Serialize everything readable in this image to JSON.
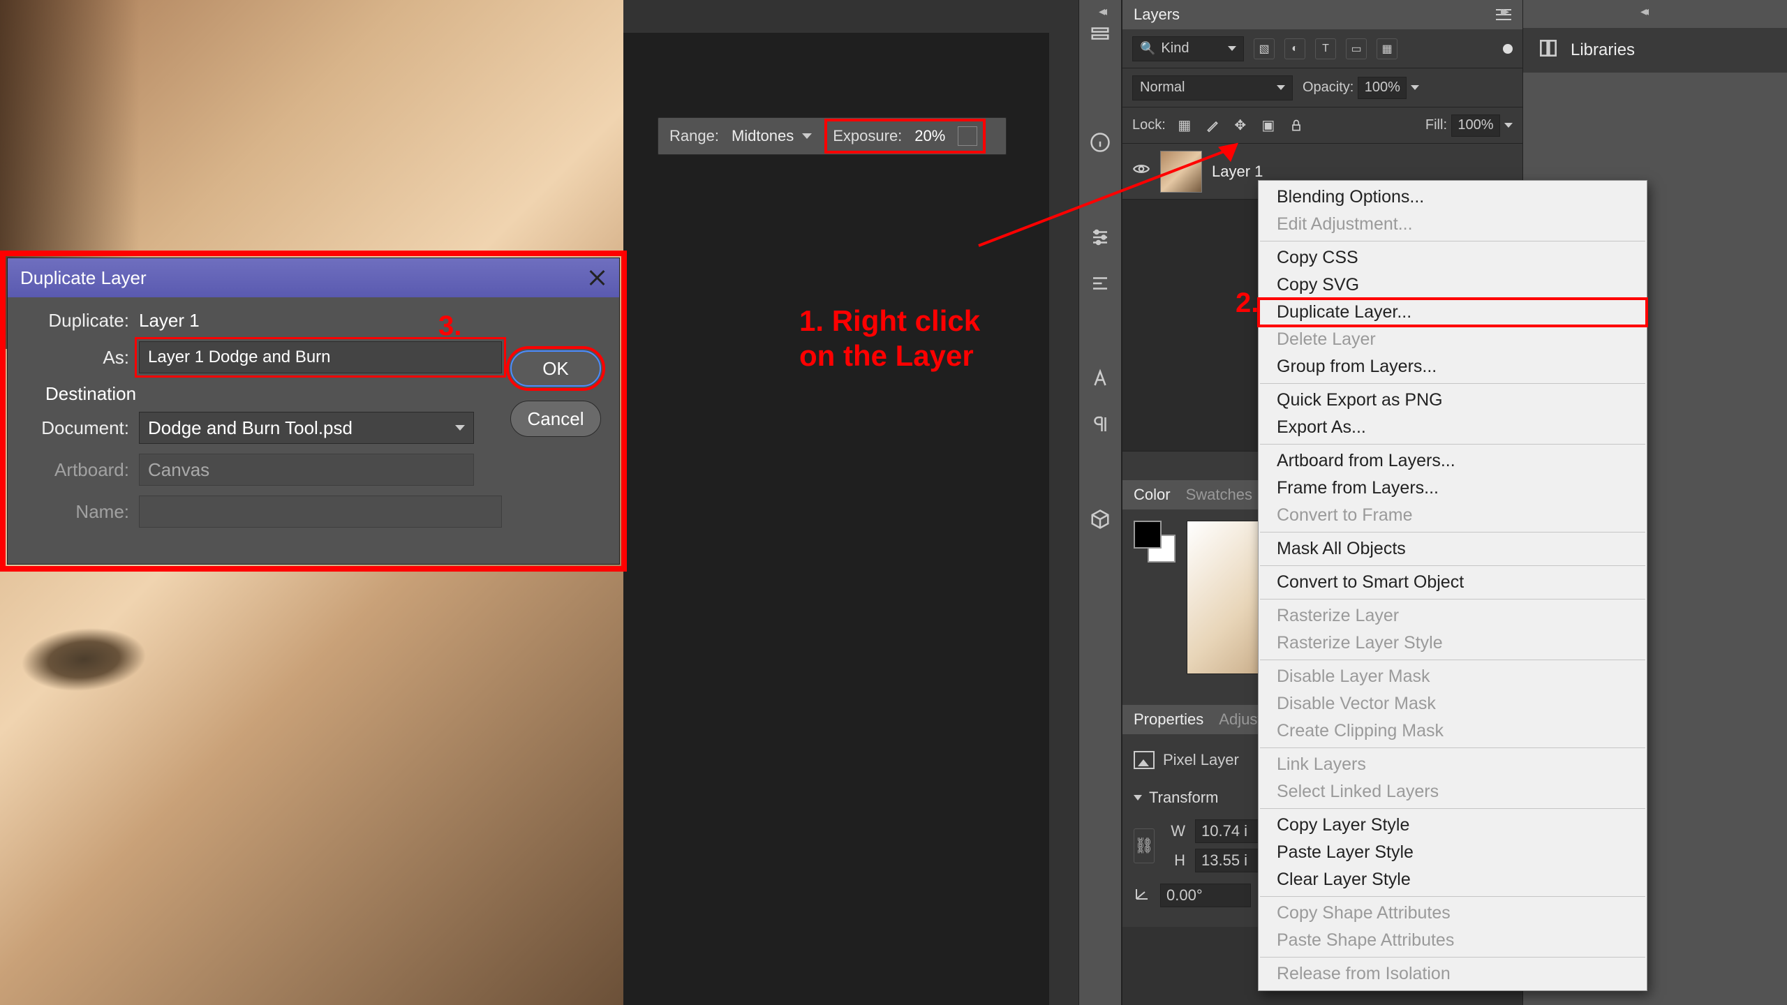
{
  "options_bar": {
    "range_label": "Range:",
    "range_value": "Midtones",
    "exposure_label": "Exposure:",
    "exposure_value": "20%"
  },
  "dialog": {
    "title": "Duplicate Layer",
    "duplicate_label": "Duplicate:",
    "duplicate_value": "Layer 1",
    "as_label": "As:",
    "as_value": "Layer 1 Dodge and Burn",
    "destination_label": "Destination",
    "document_label": "Document:",
    "document_value": "Dodge and Burn Tool.psd",
    "artboard_label": "Artboard:",
    "artboard_value": "Canvas",
    "name_label": "Name:",
    "name_value": "",
    "ok": "OK",
    "cancel": "Cancel"
  },
  "layers_panel": {
    "tab_layers": "Layers",
    "kind_label": "Kind",
    "blend_mode": "Normal",
    "opacity_label": "Opacity:",
    "opacity_value": "100%",
    "lock_label": "Lock:",
    "fill_label": "Fill:",
    "fill_value": "100%",
    "layer0_name": "Layer 1"
  },
  "color_panel": {
    "tab_color": "Color",
    "tab_swatches": "Swatches"
  },
  "properties_panel": {
    "tab_properties": "Properties",
    "tab_adjustments": "Adjustments",
    "type_label": "Pixel Layer",
    "section_transform": "Transform",
    "w_label": "W",
    "w_value": "10.74 i",
    "h_label": "H",
    "h_value": "13.55 i",
    "angle_value": "0.00°"
  },
  "libraries_panel": {
    "label": "Libraries"
  },
  "context_menu": {
    "items": [
      {
        "label": "Blending Options...",
        "disabled": false
      },
      {
        "label": "Edit Adjustment...",
        "disabled": true
      },
      {
        "label": "Copy CSS",
        "disabled": false
      },
      {
        "label": "Copy SVG",
        "disabled": false
      },
      {
        "label": "Duplicate Layer...",
        "disabled": false,
        "highlight": true
      },
      {
        "label": "Delete Layer",
        "disabled": true
      },
      {
        "label": "Group from Layers...",
        "disabled": false
      },
      {
        "label": "Quick Export as PNG",
        "disabled": false
      },
      {
        "label": "Export As...",
        "disabled": false
      },
      {
        "label": "Artboard from Layers...",
        "disabled": false
      },
      {
        "label": "Frame from Layers...",
        "disabled": false
      },
      {
        "label": "Convert to Frame",
        "disabled": true
      },
      {
        "label": "Mask All Objects",
        "disabled": false
      },
      {
        "label": "Convert to Smart Object",
        "disabled": false
      },
      {
        "label": "Rasterize Layer",
        "disabled": true
      },
      {
        "label": "Rasterize Layer Style",
        "disabled": true
      },
      {
        "label": "Disable Layer Mask",
        "disabled": true
      },
      {
        "label": "Disable Vector Mask",
        "disabled": true
      },
      {
        "label": "Create Clipping Mask",
        "disabled": true
      },
      {
        "label": "Link Layers",
        "disabled": true
      },
      {
        "label": "Select Linked Layers",
        "disabled": true
      },
      {
        "label": "Copy Layer Style",
        "disabled": false
      },
      {
        "label": "Paste Layer Style",
        "disabled": false
      },
      {
        "label": "Clear Layer Style",
        "disabled": false
      },
      {
        "label": "Copy Shape Attributes",
        "disabled": true
      },
      {
        "label": "Paste Shape Attributes",
        "disabled": true
      },
      {
        "label": "Release from Isolation",
        "disabled": true
      }
    ],
    "separators_after": [
      1,
      6,
      8,
      11,
      12,
      13,
      15,
      18,
      20,
      23,
      25
    ]
  },
  "annotations": {
    "step1_line1": "1. Right click",
    "step1_line2": "on the Layer",
    "step2_num": "2.",
    "step3_num": "3."
  }
}
